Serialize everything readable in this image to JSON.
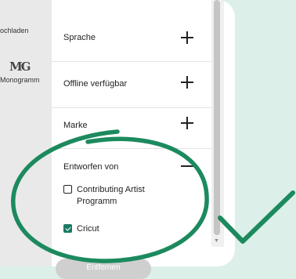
{
  "sidebar": {
    "download_label": "ochladen",
    "monogram_icon": "monogram-icon",
    "monogram_icon_text": "MG",
    "monogram_label": "Monogramm"
  },
  "filters": {
    "rows": [
      {
        "label": "Sprache",
        "icon": "plus-icon"
      },
      {
        "label": "Offline verfügbar",
        "icon": "plus-icon"
      },
      {
        "label": "Marke",
        "icon": "plus-icon"
      }
    ],
    "designed_by": {
      "label": "Entworfen von",
      "icon": "minus-icon",
      "options": [
        {
          "label": "Contributing Artist Programm",
          "checked": false
        },
        {
          "label": "Cricut",
          "checked": true
        }
      ]
    }
  },
  "remove_button": {
    "label": "Entfernen"
  },
  "annotation": {
    "color": "#1c8a5e",
    "shapes": [
      "ellipse",
      "check-mark"
    ]
  },
  "colors": {
    "accent": "#1c7a63",
    "background": "#dcefe8"
  }
}
